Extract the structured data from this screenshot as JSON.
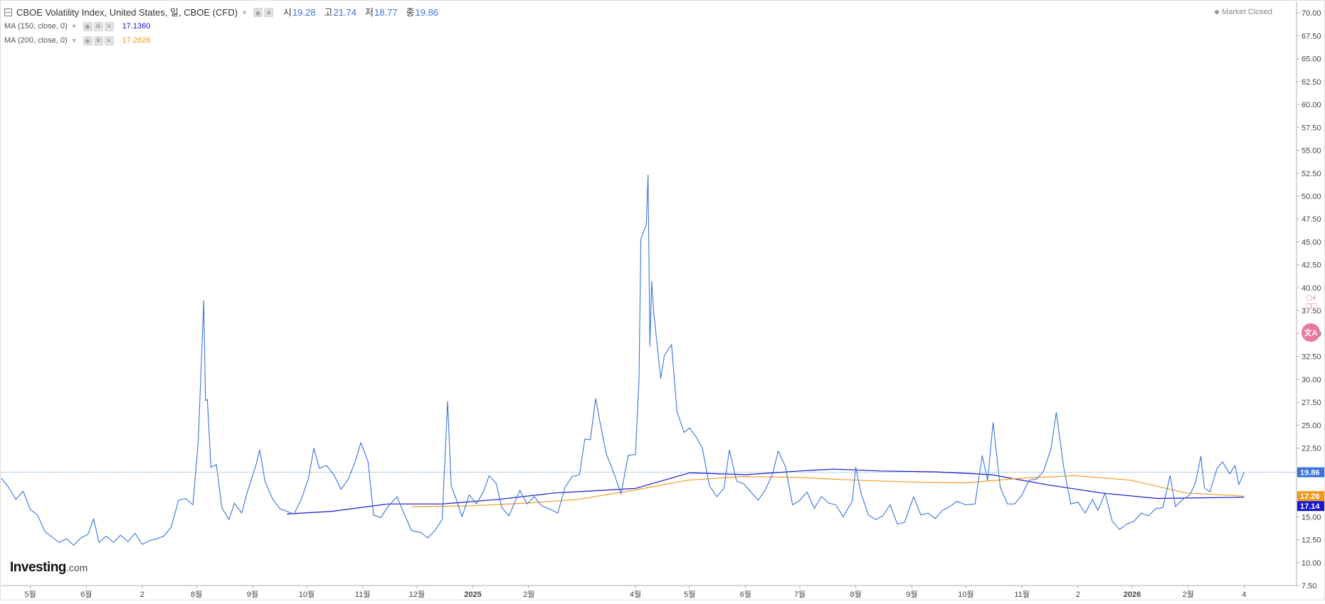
{
  "legend": {
    "main": {
      "title": "CBOE Volatility Index, United States, 일, CBOE (CFD)",
      "open_label": "시",
      "open": "19.28",
      "high_label": "고",
      "high": "21.74",
      "low_label": "저",
      "low": "18.77",
      "close_label": "종",
      "close": "19.86"
    },
    "ma150": {
      "label": "MA (150, close, 0)",
      "value": "17.1360",
      "color": "#1717cc"
    },
    "ma200": {
      "label": "MA (200, close, 0)",
      "value": "17.2626",
      "color": "#f29a1c"
    }
  },
  "market_status": "Market Closed",
  "brand": {
    "name": "Investing",
    "suffix": ".com"
  },
  "icons": [
    "collapse-icon",
    "caret-down-icon",
    "eye-icon",
    "settings-icon",
    "close-icon",
    "compare-add-icon",
    "translate-icon"
  ],
  "colors": {
    "price_line": "#3a74d8",
    "ma150": "#1717cc",
    "ma200": "#f29a1c",
    "price_tag": "#3a74d8"
  },
  "price_tags": [
    {
      "text": "19.86",
      "value": 19.86,
      "color": "#3a74d8"
    },
    {
      "text": "17.26",
      "value": 17.26,
      "color": "#f29a1c"
    },
    {
      "text": "17.14",
      "value": 17.14,
      "color": "#1717cc"
    }
  ],
  "chart_data": {
    "type": "line",
    "title": "CBOE Volatility Index, United States, 일, CBOE (CFD)",
    "ylim": [
      7.5,
      71.25
    ],
    "yticks": [
      "7.50",
      "10.00",
      "12.50",
      "15.00",
      "17.50",
      "20.00",
      "22.50",
      "25.00",
      "27.50",
      "30.00",
      "32.50",
      "35.00",
      "37.50",
      "40.00",
      "42.50",
      "45.00",
      "47.50",
      "50.00",
      "52.50",
      "55.00",
      "57.50",
      "60.00",
      "62.50",
      "65.00",
      "67.50",
      "70.00"
    ],
    "xlim": [
      "2024-04-15",
      "2026-04-02"
    ],
    "xticks": [
      {
        "label": "5월",
        "date": "2024-05-01"
      },
      {
        "label": "6월",
        "date": "2024-06-01"
      },
      {
        "label": "2",
        "date": "2024-07-02"
      },
      {
        "label": "8월",
        "date": "2024-08-01"
      },
      {
        "label": "9월",
        "date": "2024-09-01"
      },
      {
        "label": "10월",
        "date": "2024-10-01"
      },
      {
        "label": "11월",
        "date": "2024-11-01"
      },
      {
        "label": "12월",
        "date": "2024-12-01"
      },
      {
        "label": "2025",
        "date": "2025-01-01"
      },
      {
        "label": "2월",
        "date": "2025-02-01"
      },
      {
        "label": "4월",
        "date": "2025-04-01"
      },
      {
        "label": "5월",
        "date": "2025-05-01"
      },
      {
        "label": "6월",
        "date": "2025-06-01"
      },
      {
        "label": "7월",
        "date": "2025-07-01"
      },
      {
        "label": "8월",
        "date": "2025-08-01"
      },
      {
        "label": "9월",
        "date": "2025-09-01"
      },
      {
        "label": "10월",
        "date": "2025-10-01"
      },
      {
        "label": "11월",
        "date": "2025-11-01"
      },
      {
        "label": "2",
        "date": "2025-12-02"
      },
      {
        "label": "2026",
        "date": "2026-01-01"
      },
      {
        "label": "2월",
        "date": "2026-02-01"
      },
      {
        "label": "4",
        "date": "2026-03-04"
      }
    ],
    "grid": false,
    "last_price_line": 19.86,
    "series": [
      {
        "name": "CBOE Volatility Index, United States, 일, CBOE (CFD)",
        "color": "#3a74d8",
        "points": [
          [
            "2024-04-15",
            19.2
          ],
          [
            "2024-04-19",
            18.2
          ],
          [
            "2024-04-23",
            16.9
          ],
          [
            "2024-04-27",
            17.8
          ],
          [
            "2024-05-01",
            15.8
          ],
          [
            "2024-05-05",
            15.2
          ],
          [
            "2024-05-09",
            13.4
          ],
          [
            "2024-05-13",
            12.8
          ],
          [
            "2024-05-17",
            12.2
          ],
          [
            "2024-05-21",
            12.6
          ],
          [
            "2024-05-25",
            11.9
          ],
          [
            "2024-05-29",
            12.7
          ],
          [
            "2024-06-02",
            13.1
          ],
          [
            "2024-06-05",
            14.8
          ],
          [
            "2024-06-08",
            12.2
          ],
          [
            "2024-06-12",
            12.9
          ],
          [
            "2024-06-16",
            12.2
          ],
          [
            "2024-06-20",
            13.0
          ],
          [
            "2024-06-24",
            12.3
          ],
          [
            "2024-06-28",
            13.2
          ],
          [
            "2024-07-02",
            12.0
          ],
          [
            "2024-07-06",
            12.4
          ],
          [
            "2024-07-10",
            12.6
          ],
          [
            "2024-07-14",
            12.9
          ],
          [
            "2024-07-18",
            13.9
          ],
          [
            "2024-07-22",
            16.8
          ],
          [
            "2024-07-26",
            17.0
          ],
          [
            "2024-07-30",
            16.3
          ],
          [
            "2024-08-02",
            23.4
          ],
          [
            "2024-08-05",
            38.6
          ],
          [
            "2024-08-06",
            27.7
          ],
          [
            "2024-08-07",
            27.8
          ],
          [
            "2024-08-09",
            20.4
          ],
          [
            "2024-08-12",
            20.7
          ],
          [
            "2024-08-15",
            16.0
          ],
          [
            "2024-08-19",
            14.7
          ],
          [
            "2024-08-22",
            16.5
          ],
          [
            "2024-08-26",
            15.4
          ],
          [
            "2024-08-29",
            17.6
          ],
          [
            "2024-09-03",
            20.7
          ],
          [
            "2024-09-05",
            22.3
          ],
          [
            "2024-09-08",
            18.8
          ],
          [
            "2024-09-12",
            17.0
          ],
          [
            "2024-09-16",
            15.9
          ],
          [
            "2024-09-20",
            15.6
          ],
          [
            "2024-09-24",
            15.3
          ],
          [
            "2024-09-28",
            16.9
          ],
          [
            "2024-10-02",
            19.2
          ],
          [
            "2024-10-05",
            22.5
          ],
          [
            "2024-10-08",
            20.3
          ],
          [
            "2024-10-12",
            20.6
          ],
          [
            "2024-10-16",
            19.6
          ],
          [
            "2024-10-20",
            18.0
          ],
          [
            "2024-10-24",
            19.1
          ],
          [
            "2024-10-28",
            21.1
          ],
          [
            "2024-10-31",
            23.1
          ],
          [
            "2024-11-04",
            21.0
          ],
          [
            "2024-11-07",
            15.2
          ],
          [
            "2024-11-11",
            14.9
          ],
          [
            "2024-11-15",
            16.1
          ],
          [
            "2024-11-20",
            17.2
          ],
          [
            "2024-11-24",
            15.3
          ],
          [
            "2024-11-28",
            13.5
          ],
          [
            "2024-12-03",
            13.3
          ],
          [
            "2024-12-07",
            12.7
          ],
          [
            "2024-12-11",
            13.5
          ],
          [
            "2024-12-15",
            14.7
          ],
          [
            "2024-12-18",
            27.6
          ],
          [
            "2024-12-20",
            18.4
          ],
          [
            "2024-12-23",
            16.8
          ],
          [
            "2024-12-26",
            15.0
          ],
          [
            "2024-12-30",
            17.4
          ],
          [
            "2025-01-03",
            16.4
          ],
          [
            "2025-01-07",
            17.8
          ],
          [
            "2025-01-10",
            19.5
          ],
          [
            "2025-01-14",
            18.6
          ],
          [
            "2025-01-17",
            16.0
          ],
          [
            "2025-01-21",
            15.1
          ],
          [
            "2025-01-27",
            17.9
          ],
          [
            "2025-01-31",
            16.4
          ],
          [
            "2025-02-04",
            17.2
          ],
          [
            "2025-02-08",
            16.2
          ],
          [
            "2025-02-12",
            15.9
          ],
          [
            "2025-02-17",
            15.4
          ],
          [
            "2025-02-21",
            18.2
          ],
          [
            "2025-02-25",
            19.4
          ],
          [
            "2025-03-01",
            19.6
          ],
          [
            "2025-03-04",
            23.5
          ],
          [
            "2025-03-07",
            23.4
          ],
          [
            "2025-03-10",
            27.9
          ],
          [
            "2025-03-13",
            24.7
          ],
          [
            "2025-03-16",
            21.8
          ],
          [
            "2025-03-20",
            19.8
          ],
          [
            "2025-03-24",
            17.5
          ],
          [
            "2025-03-28",
            21.7
          ],
          [
            "2025-04-01",
            21.8
          ],
          [
            "2025-04-03",
            30.0
          ],
          [
            "2025-04-04",
            45.3
          ],
          [
            "2025-04-07",
            46.9
          ],
          [
            "2025-04-08",
            52.3
          ],
          [
            "2025-04-09",
            33.6
          ],
          [
            "2025-04-10",
            40.7
          ],
          [
            "2025-04-11",
            37.6
          ],
          [
            "2025-04-15",
            30.1
          ],
          [
            "2025-04-17",
            32.6
          ],
          [
            "2025-04-21",
            33.8
          ],
          [
            "2025-04-24",
            26.5
          ],
          [
            "2025-04-28",
            24.2
          ],
          [
            "2025-05-01",
            24.7
          ],
          [
            "2025-05-05",
            23.6
          ],
          [
            "2025-05-08",
            22.5
          ],
          [
            "2025-05-12",
            18.4
          ],
          [
            "2025-05-16",
            17.2
          ],
          [
            "2025-05-20",
            18.1
          ],
          [
            "2025-05-23",
            22.3
          ],
          [
            "2025-05-27",
            18.9
          ],
          [
            "2025-05-31",
            18.6
          ],
          [
            "2025-06-04",
            17.7
          ],
          [
            "2025-06-08",
            16.8
          ],
          [
            "2025-06-12",
            18.0
          ],
          [
            "2025-06-16",
            19.7
          ],
          [
            "2025-06-19",
            22.2
          ],
          [
            "2025-06-23",
            20.5
          ],
          [
            "2025-06-27",
            16.3
          ],
          [
            "2025-07-01",
            16.8
          ],
          [
            "2025-07-05",
            17.7
          ],
          [
            "2025-07-09",
            15.9
          ],
          [
            "2025-07-13",
            17.2
          ],
          [
            "2025-07-17",
            16.5
          ],
          [
            "2025-07-21",
            16.3
          ],
          [
            "2025-07-25",
            15.0
          ],
          [
            "2025-07-30",
            16.7
          ],
          [
            "2025-08-01",
            20.4
          ],
          [
            "2025-08-04",
            17.5
          ],
          [
            "2025-08-08",
            15.2
          ],
          [
            "2025-08-12",
            14.7
          ],
          [
            "2025-08-16",
            15.1
          ],
          [
            "2025-08-20",
            16.3
          ],
          [
            "2025-08-24",
            14.2
          ],
          [
            "2025-08-28",
            14.4
          ],
          [
            "2025-09-02",
            17.2
          ],
          [
            "2025-09-06",
            15.2
          ],
          [
            "2025-09-10",
            15.4
          ],
          [
            "2025-09-14",
            14.8
          ],
          [
            "2025-09-18",
            15.7
          ],
          [
            "2025-09-22",
            16.1
          ],
          [
            "2025-09-26",
            16.7
          ],
          [
            "2025-10-01",
            16.3
          ],
          [
            "2025-10-06",
            16.4
          ],
          [
            "2025-10-10",
            21.7
          ],
          [
            "2025-10-13",
            19.0
          ],
          [
            "2025-10-16",
            25.3
          ],
          [
            "2025-10-20",
            18.2
          ],
          [
            "2025-10-24",
            16.4
          ],
          [
            "2025-10-28",
            16.4
          ],
          [
            "2025-11-01",
            17.4
          ],
          [
            "2025-11-05",
            19.0
          ],
          [
            "2025-11-09",
            19.1
          ],
          [
            "2025-11-13",
            20.0
          ],
          [
            "2025-11-17",
            22.4
          ],
          [
            "2025-11-20",
            26.4
          ],
          [
            "2025-11-24",
            20.5
          ],
          [
            "2025-11-28",
            16.4
          ],
          [
            "2025-12-02",
            16.6
          ],
          [
            "2025-12-06",
            15.4
          ],
          [
            "2025-12-10",
            16.9
          ],
          [
            "2025-12-13",
            15.7
          ],
          [
            "2025-12-17",
            17.6
          ],
          [
            "2025-12-21",
            14.5
          ],
          [
            "2025-12-25",
            13.6
          ],
          [
            "2025-12-29",
            14.2
          ],
          [
            "2026-01-02",
            14.5
          ],
          [
            "2026-01-06",
            15.4
          ],
          [
            "2026-01-10",
            15.1
          ],
          [
            "2026-01-14",
            15.9
          ],
          [
            "2026-01-18",
            16.0
          ],
          [
            "2026-01-22",
            19.5
          ],
          [
            "2026-01-25",
            16.1
          ],
          [
            "2026-01-29",
            16.9
          ],
          [
            "2026-02-02",
            17.4
          ],
          [
            "2026-02-05",
            18.7
          ],
          [
            "2026-02-08",
            21.6
          ],
          [
            "2026-02-10",
            18.2
          ],
          [
            "2026-02-13",
            17.7
          ],
          [
            "2026-02-17",
            20.3
          ],
          [
            "2026-02-20",
            21.0
          ],
          [
            "2026-02-24",
            19.7
          ],
          [
            "2026-02-27",
            20.6
          ],
          [
            "2026-03-01",
            18.5
          ],
          [
            "2026-03-04",
            19.86
          ]
        ]
      },
      {
        "name": "MA (150, close, 0)",
        "color": "#1717cc",
        "points": [
          [
            "2024-09-20",
            15.3
          ],
          [
            "2024-10-15",
            15.6
          ],
          [
            "2024-11-15",
            16.4
          ],
          [
            "2024-12-15",
            16.4
          ],
          [
            "2025-01-15",
            16.9
          ],
          [
            "2025-02-15",
            17.6
          ],
          [
            "2025-03-15",
            17.9
          ],
          [
            "2025-04-01",
            18.1
          ],
          [
            "2025-05-01",
            19.8
          ],
          [
            "2025-06-01",
            19.6
          ],
          [
            "2025-07-01",
            20.0
          ],
          [
            "2025-07-20",
            20.2
          ],
          [
            "2025-08-15",
            20.0
          ],
          [
            "2025-09-15",
            19.9
          ],
          [
            "2025-10-15",
            19.6
          ],
          [
            "2025-11-15",
            18.5
          ],
          [
            "2025-12-15",
            17.6
          ],
          [
            "2026-01-15",
            17.0
          ],
          [
            "2026-03-04",
            17.14
          ]
        ]
      },
      {
        "name": "MA (200, close, 0)",
        "color": "#f29a1c",
        "points": [
          [
            "2024-11-28",
            16.1
          ],
          [
            "2024-12-31",
            16.2
          ],
          [
            "2025-01-31",
            16.5
          ],
          [
            "2025-02-28",
            16.9
          ],
          [
            "2025-03-31",
            17.9
          ],
          [
            "2025-04-30",
            19.0
          ],
          [
            "2025-05-31",
            19.4
          ],
          [
            "2025-06-30",
            19.3
          ],
          [
            "2025-07-31",
            19.0
          ],
          [
            "2025-08-31",
            18.8
          ],
          [
            "2025-09-30",
            18.7
          ],
          [
            "2025-10-31",
            19.2
          ],
          [
            "2025-11-30",
            19.5
          ],
          [
            "2025-12-31",
            19.0
          ],
          [
            "2026-01-31",
            17.6
          ],
          [
            "2026-03-04",
            17.26
          ]
        ]
      }
    ]
  }
}
